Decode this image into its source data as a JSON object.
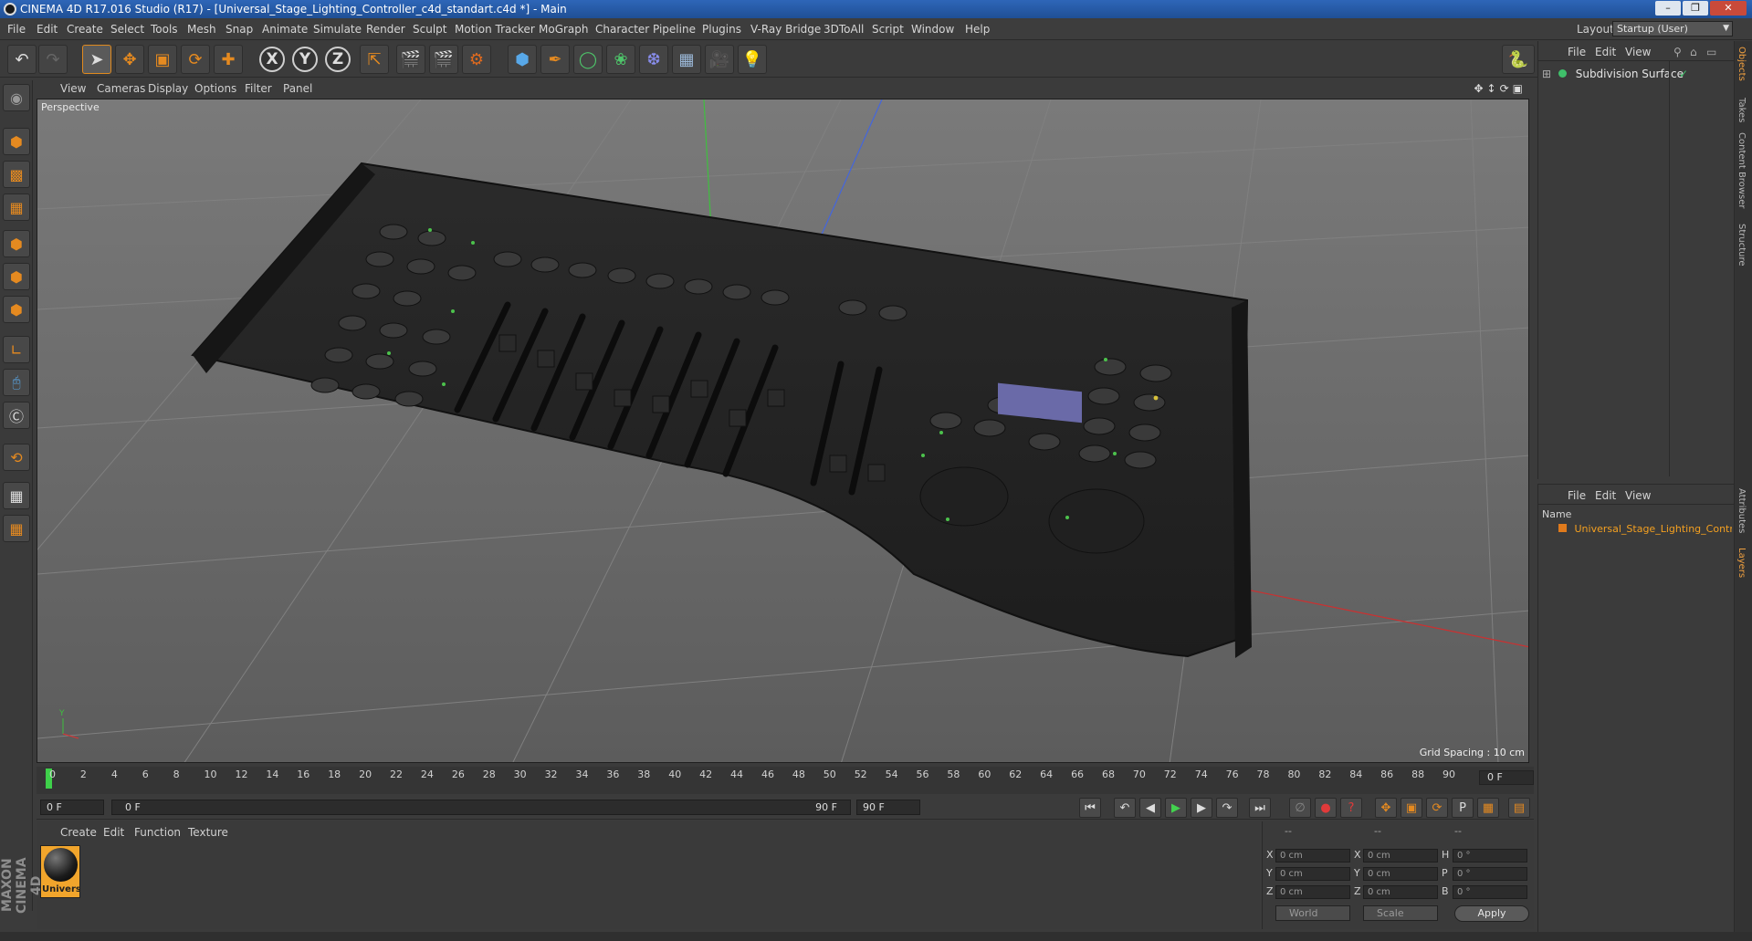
{
  "window": {
    "title": "CINEMA 4D R17.016 Studio (R17) - [Universal_Stage_Lighting_Controller_c4d_standart.c4d *] - Main"
  },
  "menubar": {
    "items": [
      "File",
      "Edit",
      "Create",
      "Select",
      "Tools",
      "Mesh",
      "Snap",
      "Animate",
      "Simulate",
      "Render",
      "Sculpt",
      "Motion Tracker",
      "MoGraph",
      "Character",
      "Pipeline",
      "Plugins",
      "V-Ray Bridge",
      "3DToAll",
      "Script",
      "Window",
      "Help"
    ],
    "layout_label": "Layout:",
    "layout_value": "Startup (User)"
  },
  "viewport": {
    "menu": [
      "View",
      "Cameras",
      "Display",
      "Options",
      "Filter",
      "Panel"
    ],
    "label": "Perspective",
    "grid_spacing": "Grid Spacing : 10 cm"
  },
  "timeline": {
    "ticks": [
      "0",
      "2",
      "4",
      "6",
      "8",
      "10",
      "12",
      "14",
      "16",
      "18",
      "20",
      "22",
      "24",
      "26",
      "28",
      "30",
      "32",
      "34",
      "36",
      "38",
      "40",
      "42",
      "44",
      "46",
      "48",
      "50",
      "52",
      "54",
      "56",
      "58",
      "60",
      "62",
      "64",
      "66",
      "68",
      "70",
      "72",
      "74",
      "76",
      "78",
      "80",
      "82",
      "84",
      "86",
      "88",
      "90"
    ],
    "end_frame": "0 F",
    "start_field": "0 F",
    "range_start": "0 F",
    "range_end": "90 F",
    "max_field": "90 F"
  },
  "material_manager": {
    "menu": [
      "Create",
      "Edit",
      "Function",
      "Texture"
    ],
    "material_name": "Univers"
  },
  "coordinates": {
    "header": [
      "--",
      "--",
      "--"
    ],
    "rows": [
      {
        "a": "X",
        "av": "0 cm",
        "b": "X",
        "bv": "0 cm",
        "c": "H",
        "cv": "0 °"
      },
      {
        "a": "Y",
        "av": "0 cm",
        "b": "Y",
        "bv": "0 cm",
        "c": "P",
        "cv": "0 °"
      },
      {
        "a": "Z",
        "av": "0 cm",
        "b": "Z",
        "bv": "0 cm",
        "c": "B",
        "cv": "0 °"
      }
    ],
    "world": "World",
    "scale": "Scale",
    "apply": "Apply"
  },
  "object_manager": {
    "menu": [
      "File",
      "Edit",
      "View"
    ],
    "object_name": "Subdivision Surface"
  },
  "layer_manager": {
    "menu": [
      "File",
      "Edit",
      "View"
    ],
    "name_header": "Name",
    "layer_name": "Universal_Stage_Lighting_Controller"
  },
  "side_tabs": [
    "Objects",
    "Takes",
    "Content Browser",
    "Structure",
    "Attributes",
    "Layers"
  ],
  "branding": "MAXON CINEMA 4D",
  "colors": {
    "accent": "#e58a20",
    "title_bar": "#1f4f95",
    "play_green": "#43d24f",
    "record_red": "#e03a3a"
  }
}
